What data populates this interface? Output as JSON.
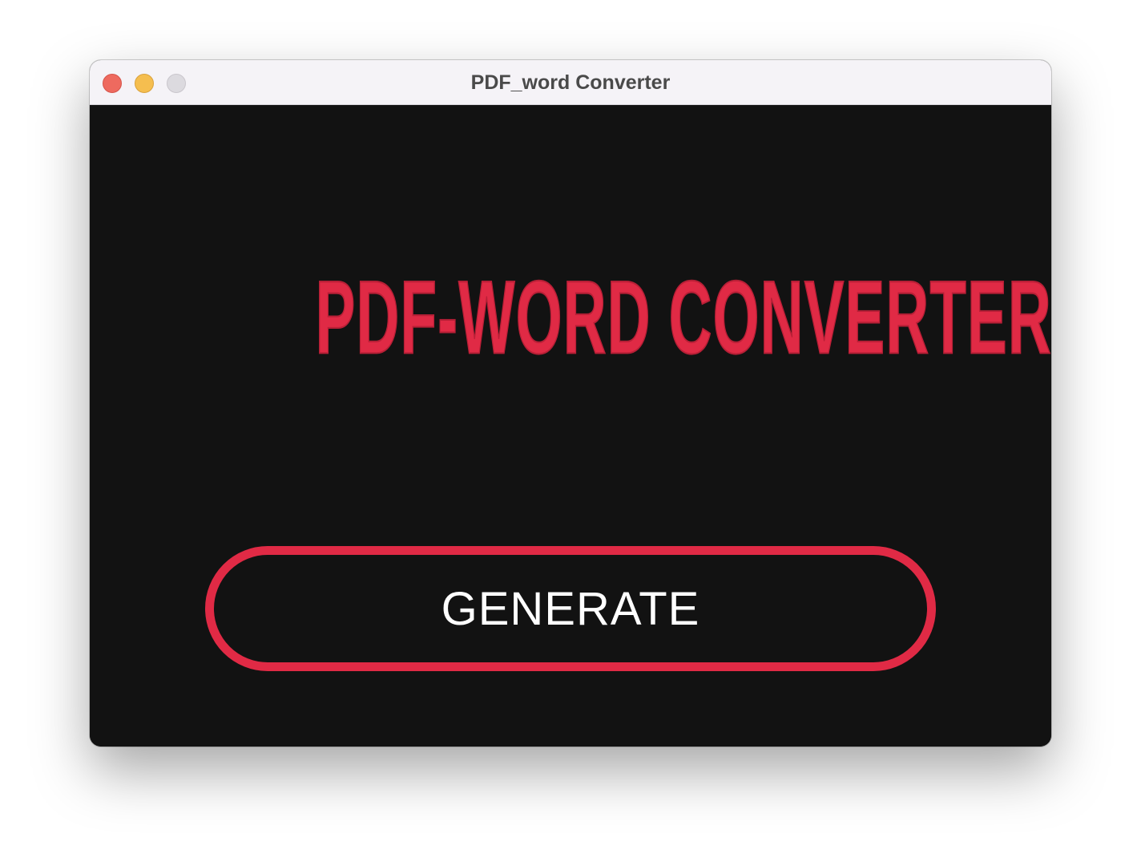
{
  "window": {
    "title": "PDF_word Converter"
  },
  "main": {
    "headline": "PDF-WORD CONVERTER",
    "generate_label": "GENERATE"
  },
  "colors": {
    "accent": "#e02a45",
    "background": "#121212",
    "titlebar": "#f5f3f7",
    "close": "#ee6a5f",
    "minimize": "#f5be4f",
    "zoom": "#dcdadf"
  },
  "icons": {
    "close": "close-icon",
    "minimize": "minimize-icon",
    "zoom": "zoom-icon"
  }
}
